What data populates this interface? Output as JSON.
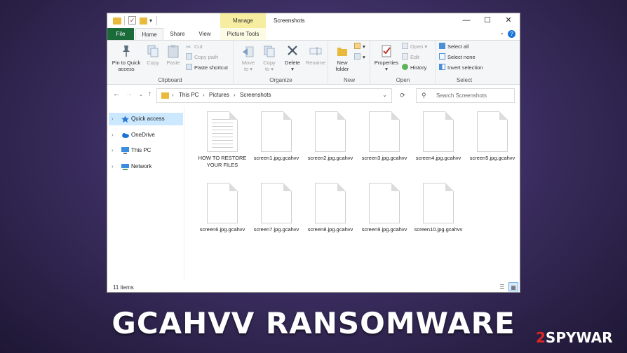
{
  "window": {
    "title": "Screenshots",
    "manage_tab": "Manage",
    "controls": {
      "minimize": "—",
      "maximize": "☐",
      "close": "✕"
    }
  },
  "tabs": {
    "file": "File",
    "home": "Home",
    "share": "Share",
    "view": "View",
    "picture_tools": "Picture Tools"
  },
  "ribbon": {
    "clipboard": {
      "label": "Clipboard",
      "pin_line1": "Pin to Quick",
      "pin_line2": "access",
      "copy": "Copy",
      "paste": "Paste",
      "cut": "Cut",
      "copy_path": "Copy path",
      "paste_shortcut": "Paste shortcut"
    },
    "organize": {
      "label": "Organize",
      "move_line1": "Move",
      "move_line2": "to ▾",
      "copy_line1": "Copy",
      "copy_line2": "to ▾",
      "delete_line1": "Delete",
      "delete_line2": "▾",
      "rename": "Rename"
    },
    "new": {
      "label": "New",
      "folder_line1": "New",
      "folder_line2": "folder"
    },
    "open": {
      "label": "Open",
      "properties_line1": "Properties",
      "properties_line2": "▾",
      "open": "Open ▾",
      "edit": "Edit",
      "history": "History"
    },
    "select": {
      "label": "Select",
      "all": "Select all",
      "none": "Select none",
      "invert": "Invert selection"
    }
  },
  "address": {
    "crumbs": [
      "This PC",
      "Pictures",
      "Screenshots"
    ],
    "search_placeholder": "Search Screenshots"
  },
  "nav": {
    "items": [
      {
        "label": "Quick access",
        "selected": true
      },
      {
        "label": "OneDrive"
      },
      {
        "label": "This PC"
      },
      {
        "label": "Network"
      }
    ]
  },
  "files": [
    "HOW TO RESTORE YOUR FILES",
    "screen1.jpg.gcahvv",
    "screen2.jpg.gcahvv",
    "screen3.jpg.gcahvv",
    "screen4.jpg.gcahvv",
    "screen5.jpg.gcahvv",
    "screen6.jpg.gcahvv",
    "screen7.jpg.gcahvv",
    "screen8.jpg.gcahvv",
    "screen9.jpg.gcahvv",
    "screen10.jpg.gcahvv"
  ],
  "status": {
    "count": "11 items"
  },
  "banner": "GCAHVV RANSOMWARE",
  "logo": {
    "number": "2",
    "text": "SPYWAR"
  }
}
